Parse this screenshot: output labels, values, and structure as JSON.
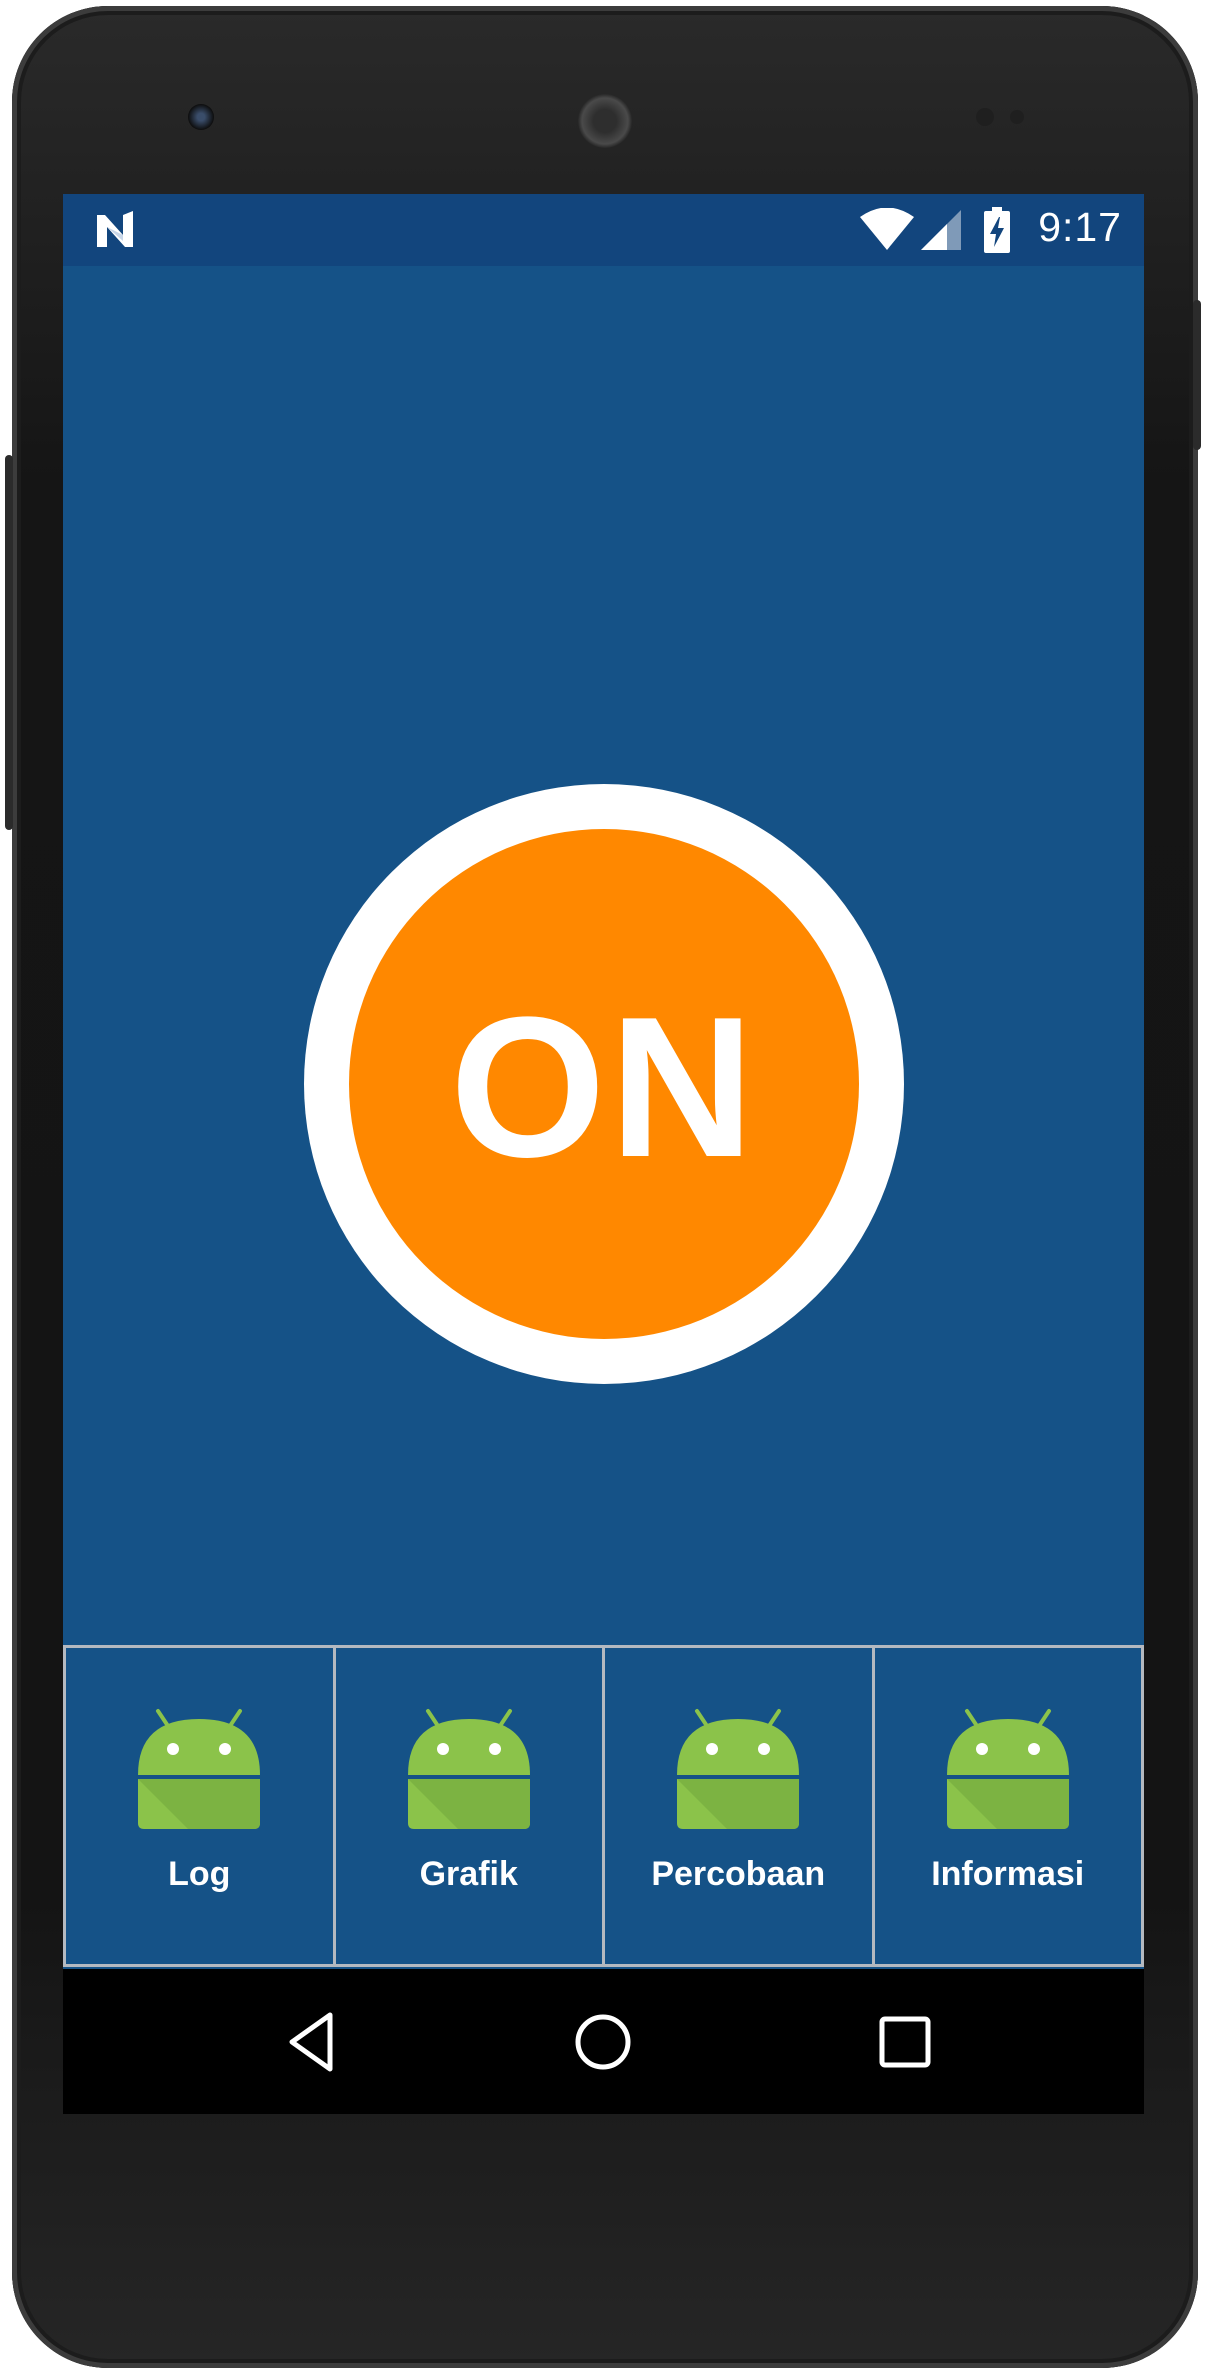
{
  "status_bar": {
    "time": "9:17",
    "notification_icon": "nougat-n-icon",
    "icons": [
      "wifi-icon",
      "cellular-signal-icon",
      "battery-charging-icon"
    ]
  },
  "power_button": {
    "label": "ON",
    "fill_color": "#ff8800",
    "ring_color": "#ffffff"
  },
  "menu": {
    "items": [
      {
        "label": "Log",
        "icon": "android-icon"
      },
      {
        "label": "Grafik",
        "icon": "android-icon"
      },
      {
        "label": "Percobaan",
        "icon": "android-icon"
      },
      {
        "label": "Informasi",
        "icon": "android-icon"
      }
    ]
  },
  "nav_bar": {
    "buttons": [
      "back-icon",
      "home-icon",
      "recents-icon"
    ]
  },
  "colors": {
    "app_background": "#155287",
    "status_bar": "#12457d",
    "accent": "#ff8800",
    "android_icon": "#8bc34a"
  }
}
